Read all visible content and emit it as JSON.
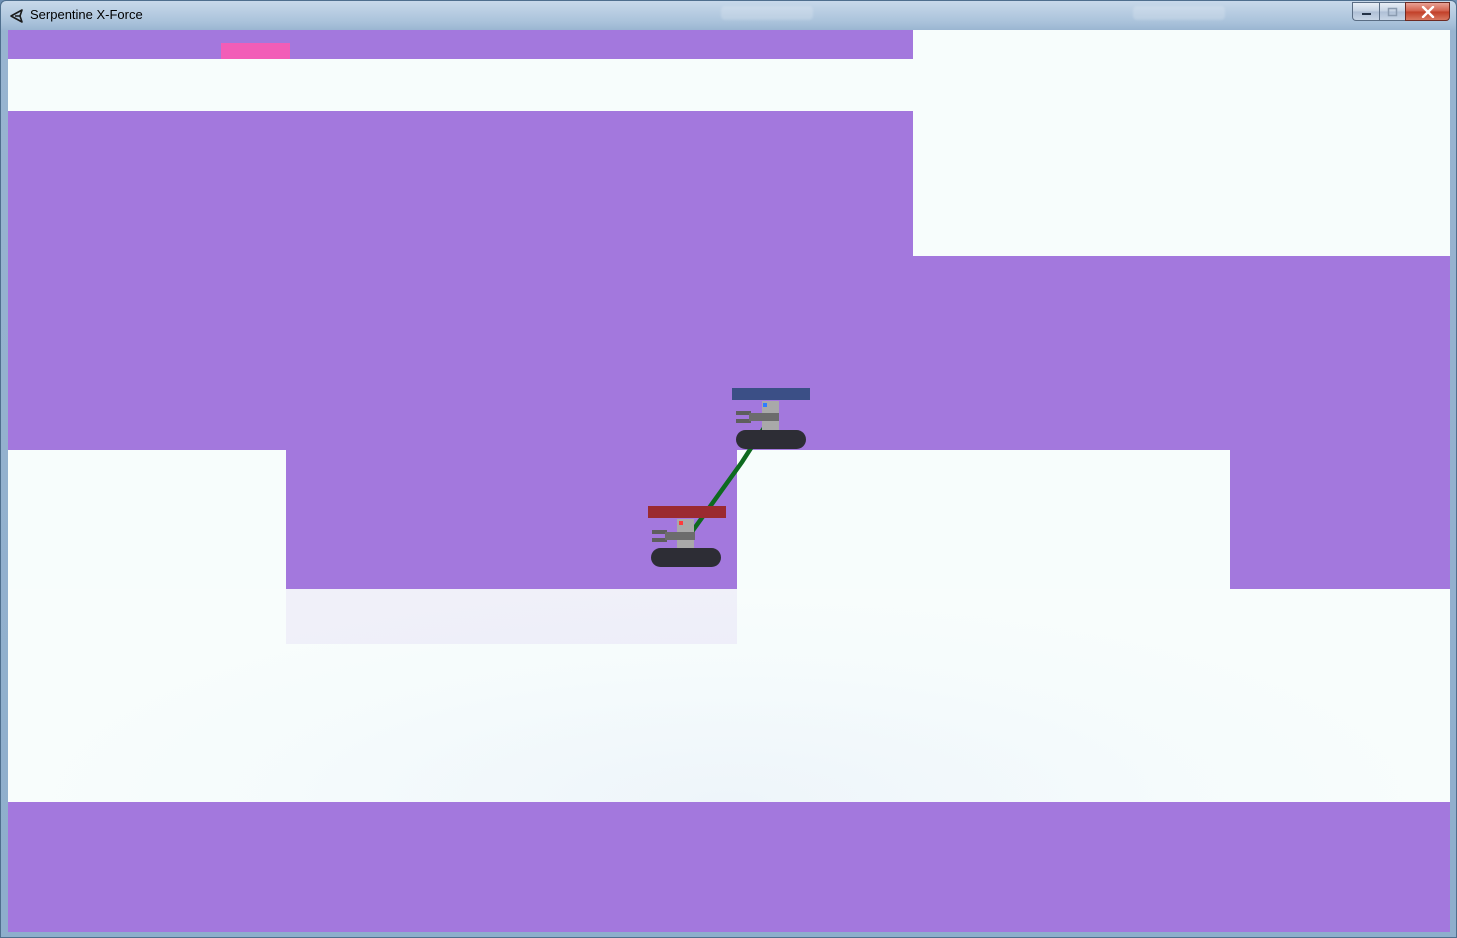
{
  "window": {
    "title": "Serpentine X-Force",
    "minimize_icon": "minimize-icon",
    "maximize_icon": "maximize-icon",
    "close_icon": "close-icon",
    "app_icon": "unity-logo-icon"
  },
  "game": {
    "background_color": "#a378dd",
    "terrain_color": "#f7fdfc",
    "goal_marker_color": "#f25db7",
    "rope_color": "#0e6a1f",
    "players": [
      {
        "name": "blue-tank",
        "health_bar_color": "#3b4f86",
        "indicator_color": "#2f7cff"
      },
      {
        "name": "red-tank",
        "health_bar_color": "#9b2a30",
        "indicator_color": "#ff3b3b"
      }
    ]
  }
}
